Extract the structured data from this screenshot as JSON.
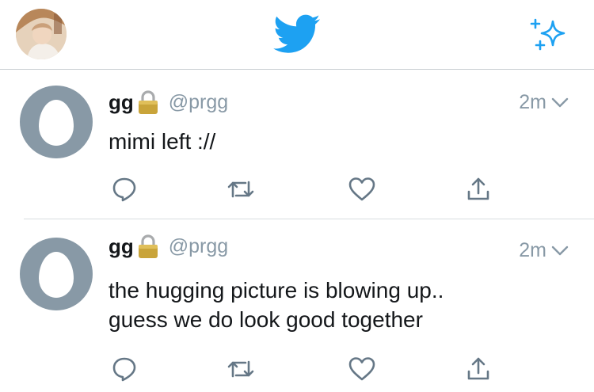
{
  "nav": {
    "profile_icon": "profile-photo",
    "logo_icon": "twitter-bird-icon",
    "compose_icon": "sparkle-icon",
    "brand_color": "#1da1f2"
  },
  "tweets": [
    {
      "name": "gg",
      "handle": "@prgg",
      "time": "2m",
      "lines": [
        "mimi left ://"
      ],
      "actions": [
        "reply-icon",
        "retweet-icon",
        "like-icon",
        "share-icon"
      ]
    },
    {
      "name": "gg",
      "handle": "@prgg",
      "time": "2m",
      "lines": [
        "the hugging picture is blowing up..",
        "guess we do look good together"
      ],
      "actions": [
        "reply-icon",
        "retweet-icon",
        "like-icon",
        "share-icon"
      ]
    }
  ],
  "colors": {
    "muted": "#8899a6",
    "text": "#14171a",
    "egg": "#8899a6",
    "divider": "#d8dcdf"
  }
}
